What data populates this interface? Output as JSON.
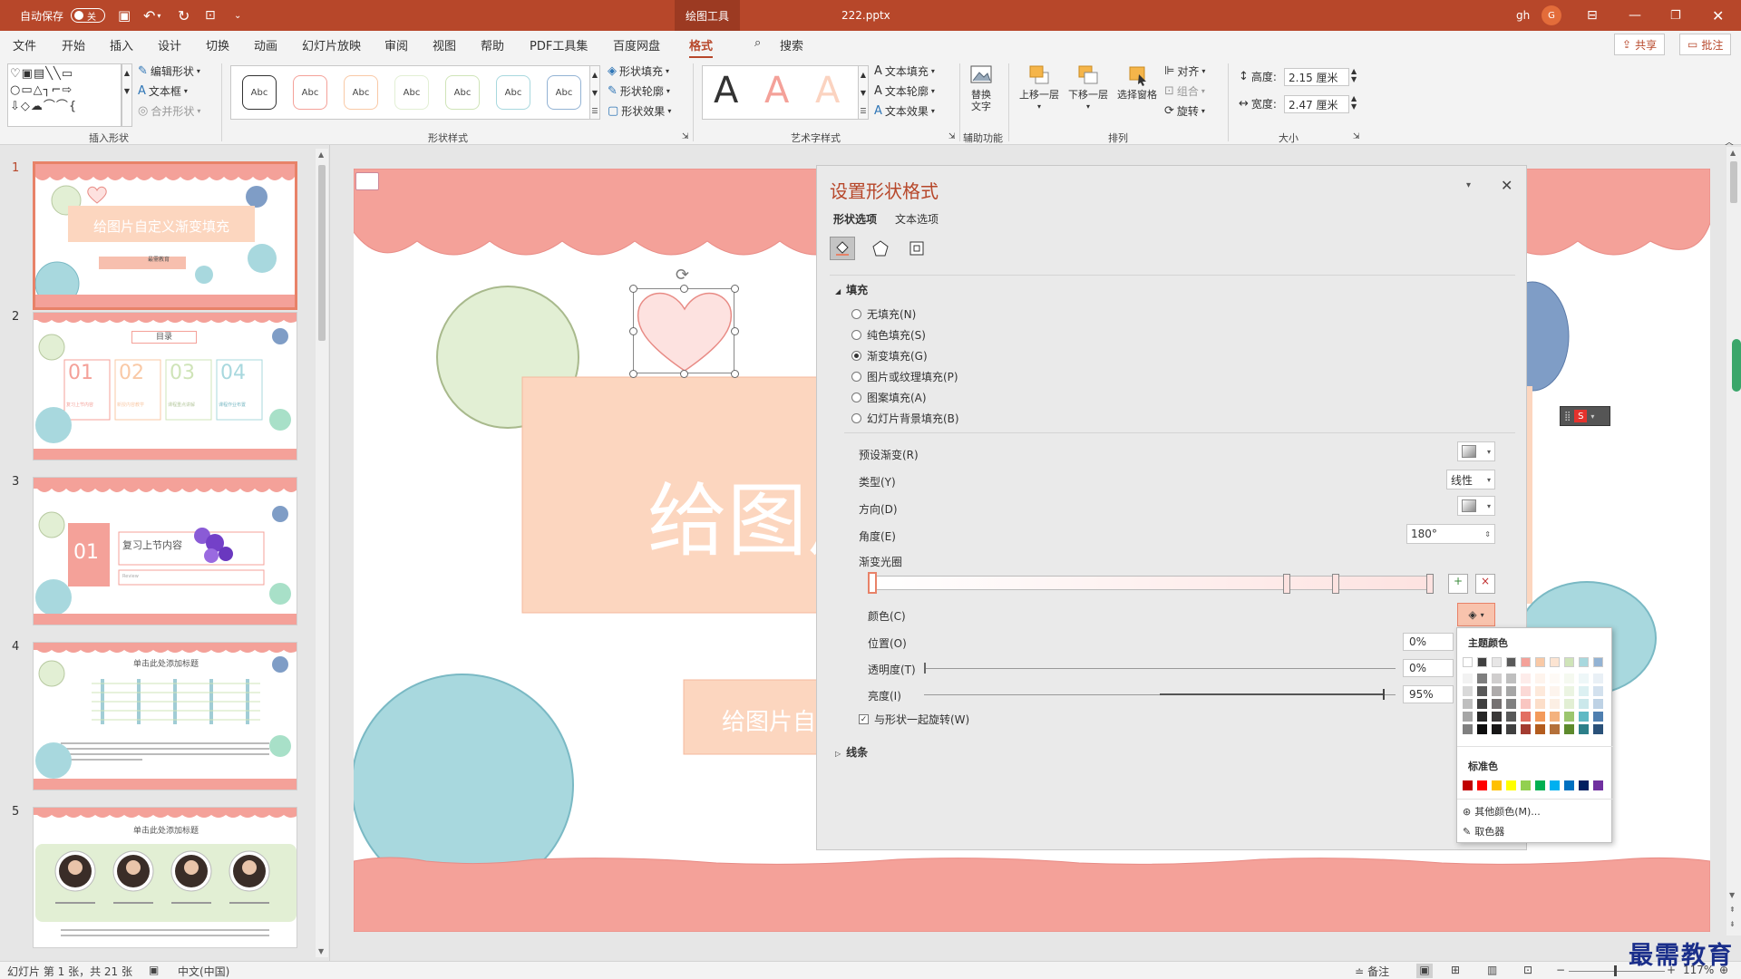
{
  "titlebar": {
    "autosave_label": "自动保存",
    "autosave_state": "关",
    "context_tab": "绘图工具",
    "filename": "222.pptx",
    "user_name": "gh",
    "user_initial": "G"
  },
  "menu": {
    "items": [
      "文件",
      "开始",
      "插入",
      "设计",
      "切换",
      "动画",
      "幻灯片放映",
      "审阅",
      "视图",
      "帮助",
      "PDF工具集",
      "百度网盘",
      "格式"
    ],
    "search": "搜索",
    "share": "共享",
    "comment": "批注"
  },
  "ribbon": {
    "insert_shapes": {
      "edit_shape": "编辑形状",
      "textbox": "文本框",
      "merge_shape": "合并形状",
      "label": "插入形状"
    },
    "shape_styles": {
      "sample": "Abc",
      "fill": "形状填充",
      "outline": "形状轮廓",
      "effect": "形状效果",
      "label": "形状样式"
    },
    "wordart": {
      "sample": "A",
      "text_fill": "文本填充",
      "text_outline": "文本轮廓",
      "text_effect": "文本效果",
      "label": "艺术字样式"
    },
    "accessibility": {
      "alt_text_1": "替换",
      "alt_text_2": "文字",
      "label": "辅助功能"
    },
    "arrange": {
      "bring_forward": "上移一层",
      "send_backward": "下移一层",
      "selection_pane": "选择窗格",
      "align": "对齐",
      "group": "组合",
      "rotate": "旋转",
      "label": "排列"
    },
    "size": {
      "height_label": "高度:",
      "height_value": "2.15 厘米",
      "width_label": "宽度:",
      "width_value": "2.47 厘米",
      "label": "大小"
    }
  },
  "thumbs": {
    "nums": [
      "1",
      "2",
      "3",
      "4",
      "5"
    ],
    "s1_title": "给图片自定义渐变填充",
    "s1_sub": "最需教育",
    "s2_title": "目录",
    "s2_numbers": [
      "01",
      "02",
      "03",
      "04"
    ],
    "s2_captions": [
      "复习上节内容",
      "新授内容教学",
      "课程重点讲解",
      "课程作业布置"
    ],
    "s3_num": "01",
    "s3_title": "复习上节内容",
    "s3_sub": "Review",
    "s4_title": "单击此处添加标题",
    "s5_title": "单击此处添加标题"
  },
  "slide": {
    "title_text": "给图片自",
    "subtitle_text": "给图片自定"
  },
  "panel": {
    "title": "设置形状格式",
    "tab_shape": "形状选项",
    "tab_text": "文本选项",
    "fill_section": "填充",
    "radios": [
      "无填充(N)",
      "纯色填充(S)",
      "渐变填充(G)",
      "图片或纹理填充(P)",
      "图案填充(A)",
      "幻灯片背景填充(B)"
    ],
    "preset_gradient": "预设渐变(R)",
    "type_label": "类型(Y)",
    "type_value": "线性",
    "direction": "方向(D)",
    "angle_label": "角度(E)",
    "angle_value": "180°",
    "gradient_stops": "渐变光圈",
    "color_label": "颜色(C)",
    "position_label": "位置(O)",
    "position_value": "0%",
    "transparency_label": "透明度(T)",
    "transparency_value": "0%",
    "brightness_label": "亮度(I)",
    "brightness_value": "95%",
    "rotate_with_shape": "与形状一起旋转(W)",
    "line_section": "线条"
  },
  "color_popup": {
    "theme_title": "主题颜色",
    "standard_title": "标准色",
    "more_colors": "其他颜色(M)...",
    "eyedropper": "取色器",
    "theme_top": [
      "#ffffff",
      "#404040",
      "#e7e6e6",
      "#595959",
      "#f4a199",
      "#f9c9a6",
      "#fce4d2",
      "#cfe4b8",
      "#a8d8de",
      "#93b3d4"
    ],
    "theme_columns": [
      [
        "#f2f2f2",
        "#d9d9d9",
        "#bfbfbf",
        "#a6a6a6",
        "#808080"
      ],
      [
        "#7f7f7f",
        "#595959",
        "#404040",
        "#262626",
        "#0d0d0d"
      ],
      [
        "#d0cece",
        "#aeabab",
        "#757171",
        "#3a3838",
        "#171616"
      ],
      [
        "#bfbfbf",
        "#a6a6a6",
        "#808080",
        "#595959",
        "#404040"
      ],
      [
        "#fdecea",
        "#fbd9d6",
        "#f9c6c1",
        "#e26f62",
        "#a33c31"
      ],
      [
        "#fef4ed",
        "#fde9db",
        "#fcdec9",
        "#f39a5b",
        "#b35c1e"
      ],
      [
        "#fefaf6",
        "#fdf4ed",
        "#fcefe4",
        "#f4b27e",
        "#b4703a"
      ],
      [
        "#f5f9f0",
        "#ebf4e2",
        "#e2efd4",
        "#9cc66e",
        "#5d8a2d"
      ],
      [
        "#eef7f8",
        "#dcf0f2",
        "#cbe8eb",
        "#5fb9c4",
        "#2c7f89"
      ],
      [
        "#e9f0f6",
        "#d3e1ee",
        "#bed2e5",
        "#4f7fb0",
        "#2a5179"
      ]
    ],
    "standard": [
      "#c00000",
      "#ff0000",
      "#ffc000",
      "#ffff00",
      "#92d050",
      "#00b050",
      "#00b0f0",
      "#0070c0",
      "#002060",
      "#7030a0"
    ]
  },
  "status": {
    "slide_info": "幻灯片 第 1 张，共 21 张",
    "language": "中文(中国)",
    "notes": "备注",
    "zoom": "117%"
  },
  "watermark": "最需教育"
}
